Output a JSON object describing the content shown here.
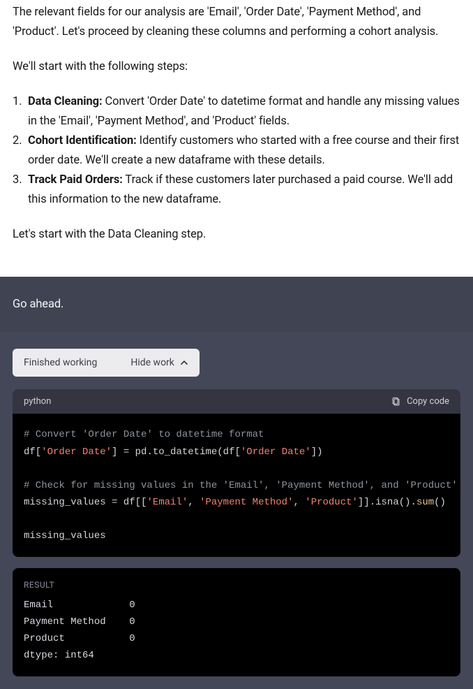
{
  "intro": {
    "p1": "The relevant fields for our analysis are 'Email', 'Order Date', 'Payment Method', and 'Product'. Let's proceed by cleaning these columns and performing a cohort analysis.",
    "p2": "We'll start with the following steps:",
    "p3": "Let's start with the Data Cleaning step."
  },
  "steps": [
    {
      "title": "Data Cleaning:",
      "text": " Convert 'Order Date' to datetime format and handle any missing values in the 'Email', 'Payment Method', and 'Product' fields."
    },
    {
      "title": "Cohort Identification:",
      "text": " Identify customers who started with a free course and their first order date. We'll create a new dataframe with these details."
    },
    {
      "title": "Track Paid Orders:",
      "text": " Track if these customers later purchased a paid course. We'll add this information to the new dataframe."
    }
  ],
  "user_message": "Go ahead.",
  "pill": {
    "status": "Finished working",
    "hide": "Hide work"
  },
  "code": {
    "lang": "python",
    "copy": "Copy code",
    "lines": {
      "c1": "# Convert 'Order Date' to datetime format",
      "l2a": "df[",
      "l2s1": "'Order Date'",
      "l2b": "] = pd.to_datetime(df[",
      "l2s2": "'Order Date'",
      "l2c": "])",
      "c2": "# Check for missing values in the 'Email', 'Payment Method', and 'Product' fields",
      "l4a": "missing_values = df[[",
      "l4s1": "'Email'",
      "l4b": ", ",
      "l4s2": "'Payment Method'",
      "l4c": ", ",
      "l4s3": "'Product'",
      "l4d": "]].isna().",
      "l4fn": "sum",
      "l4e": "()",
      "l5": "missing_values"
    }
  },
  "result": {
    "label": "RESULT",
    "body": "Email             0\nPayment Method    0\nProduct           0\ndtype: int64"
  }
}
